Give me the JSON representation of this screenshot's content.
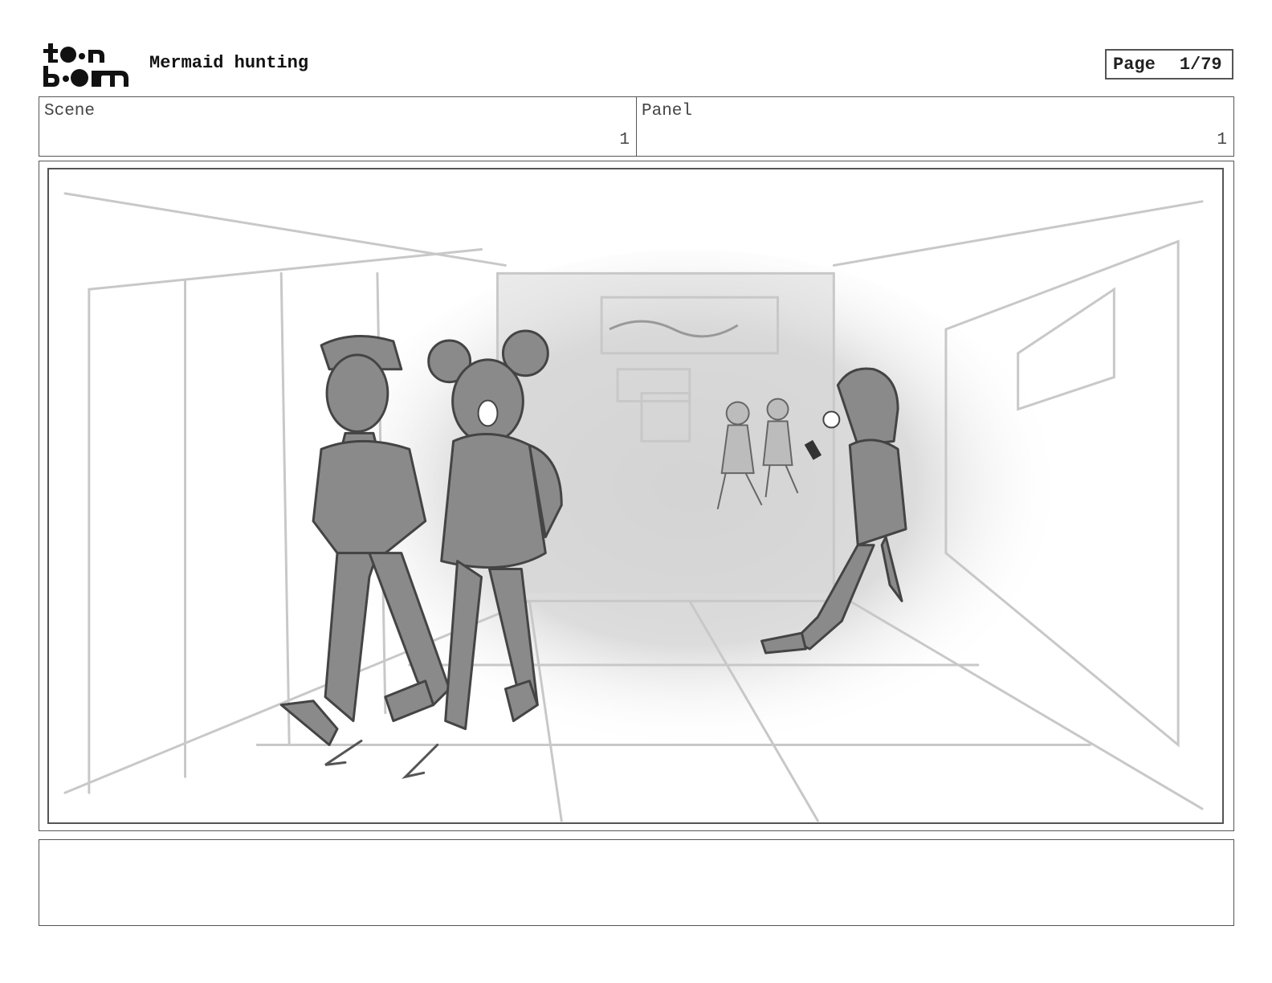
{
  "header": {
    "logo_text": "toon boom",
    "project_title": "Mermaid hunting",
    "page_label": "Page",
    "page_number": "1/79"
  },
  "scene": {
    "label": "Scene",
    "value": "1"
  },
  "panel": {
    "label": "Panel",
    "value": "1"
  },
  "notes": {
    "text": ""
  }
}
